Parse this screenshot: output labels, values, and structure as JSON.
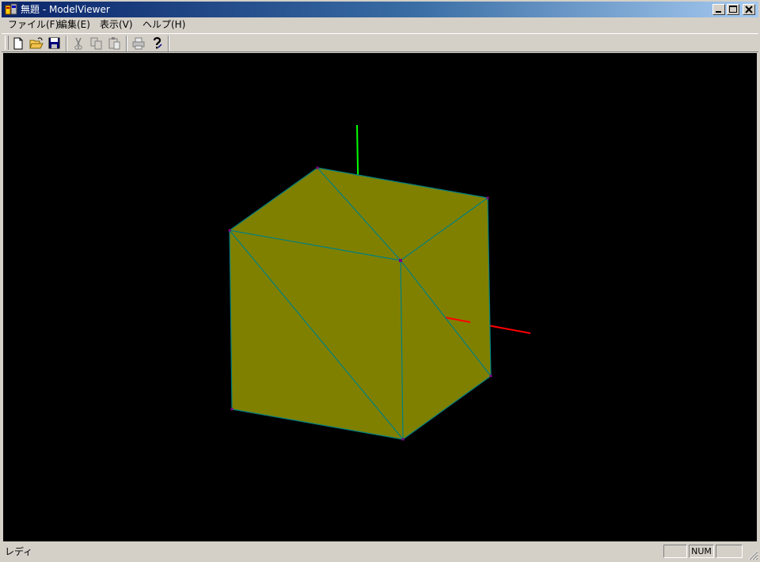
{
  "window": {
    "title": "無題 - ModelViewer",
    "buttons": [
      "minimize",
      "maximize",
      "close"
    ]
  },
  "menubar": {
    "items": [
      {
        "label": "ファイル(F)"
      },
      {
        "label": "編集(E)"
      },
      {
        "label": "表示(V)"
      },
      {
        "label": "ヘルプ(H)"
      }
    ]
  },
  "toolbar": {
    "buttons": [
      {
        "icon": "new-file-icon",
        "enabled": true
      },
      {
        "icon": "open-folder-icon",
        "enabled": true
      },
      {
        "icon": "save-icon",
        "enabled": true
      },
      {
        "icon": "cut-icon",
        "enabled": false
      },
      {
        "icon": "copy-icon",
        "enabled": false
      },
      {
        "icon": "paste-icon",
        "enabled": false
      },
      {
        "icon": "print-icon",
        "enabled": false
      },
      {
        "icon": "help-icon",
        "enabled": true
      }
    ]
  },
  "viewport": {
    "background": "#000000",
    "face_color": "#808000",
    "edge_color": "#008080",
    "vertex_color": "#800080",
    "axes": {
      "x": "#ff0000",
      "y": "#00ff00",
      "z": "#0000aa"
    }
  },
  "statusbar": {
    "text": "レディ",
    "panels": [
      "",
      "NUM",
      ""
    ]
  }
}
